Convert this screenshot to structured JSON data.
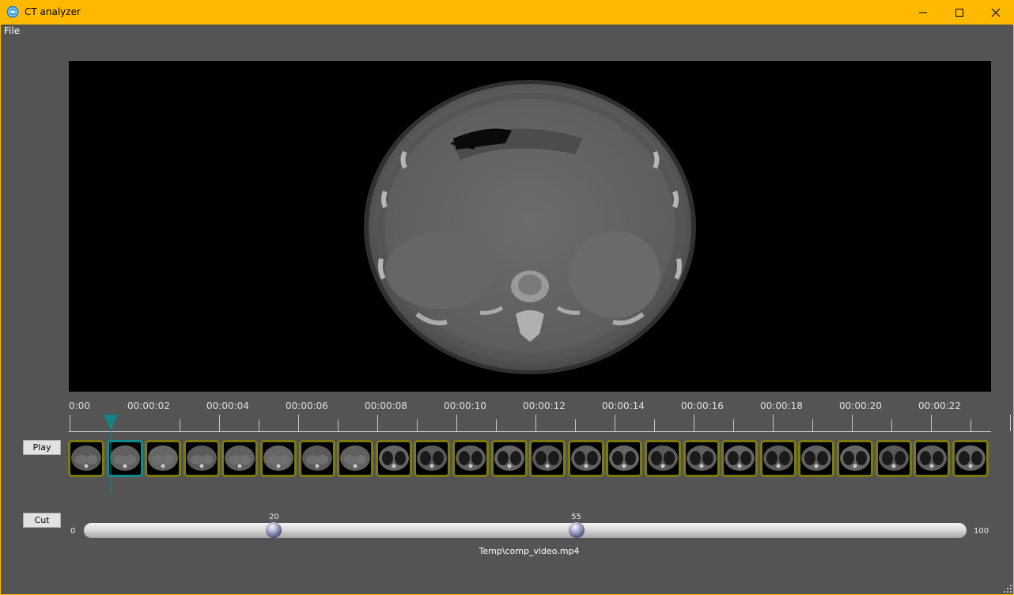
{
  "window": {
    "title": "CT analyzer",
    "accent_color": "#ffb900",
    "app_icon": "app-globe-icon"
  },
  "menu": {
    "file": "File"
  },
  "timeline": {
    "labels": [
      "0:00",
      "00:00:02",
      "00:00:04",
      "00:00:06",
      "00:00:08",
      "00:00:10",
      "00:00:12",
      "00:00:14",
      "00:00:16",
      "00:00:18",
      "00:00:20",
      "00:00:22"
    ],
    "thumbnail_count": 24,
    "selected_index": 1
  },
  "controls": {
    "play_label": "Play",
    "cut_label": "Cut"
  },
  "range_slider": {
    "min_label": "0",
    "max_label": "100",
    "min": 0,
    "max": 100,
    "low": 20,
    "high": 55,
    "low_label": "20",
    "high_label": "55"
  },
  "file_name": "Temp\\comp_video.mp4",
  "colors": {
    "thumb_border": "#7c7a10",
    "selected_border": "#118a8c",
    "background": "#545454"
  }
}
